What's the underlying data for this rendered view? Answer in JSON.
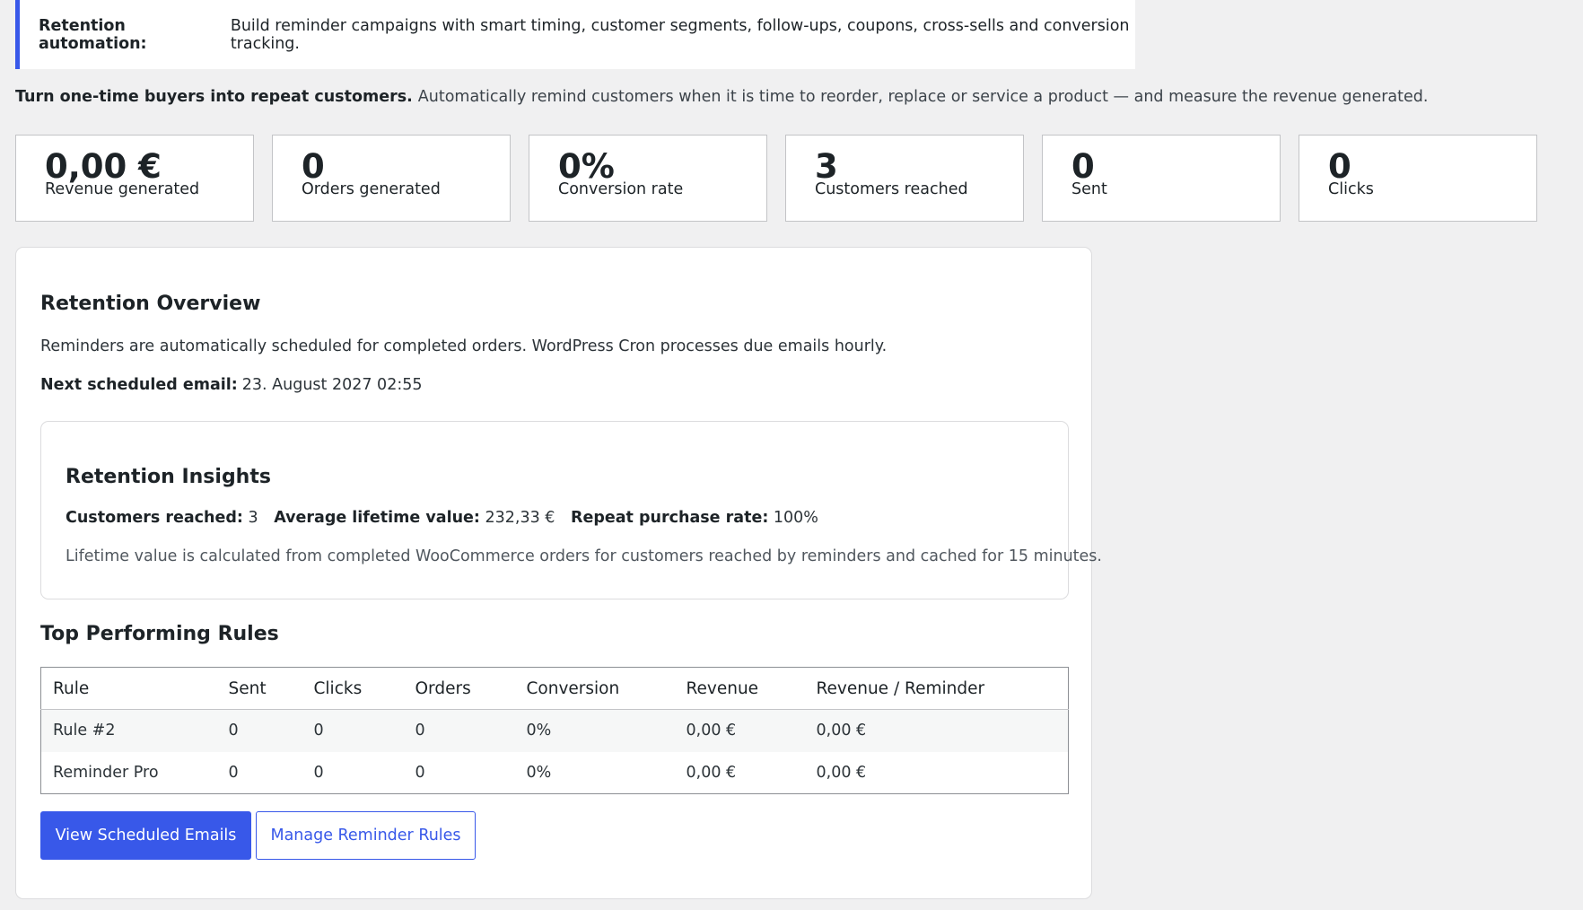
{
  "notice": {
    "title": "Retention automation:",
    "text": "Build reminder campaigns with smart timing, customer segments, follow-ups, coupons, cross-sells and conversion tracking."
  },
  "intro": {
    "bold": "Turn one-time buyers into repeat customers.",
    "text": "Automatically remind customers when it is time to reorder, replace or service a product — and measure the revenue generated."
  },
  "kpis": [
    {
      "value": "0,00 €",
      "label": "Revenue generated"
    },
    {
      "value": "0",
      "label": "Orders generated"
    },
    {
      "value": "0%",
      "label": "Conversion rate"
    },
    {
      "value": "3",
      "label": "Customers reached"
    },
    {
      "value": "0",
      "label": "Sent"
    },
    {
      "value": "0",
      "label": "Clicks"
    }
  ],
  "overview": {
    "title": "Retention Overview",
    "description": "Reminders are automatically scheduled for completed orders. WordPress Cron processes due emails hourly.",
    "next_label": "Next scheduled email:",
    "next_value": "23. August 2027 02:55"
  },
  "insights": {
    "title": "Retention Insights",
    "customers_label": "Customers reached:",
    "customers_value": "3",
    "ltv_label": "Average lifetime value:",
    "ltv_value": "232,33 €",
    "repeat_label": "Repeat purchase rate:",
    "repeat_value": "100%",
    "note": "Lifetime value is calculated from completed WooCommerce orders for customers reached by reminders and cached for 15 minutes."
  },
  "rules": {
    "title": "Top Performing Rules",
    "columns": [
      "Rule",
      "Sent",
      "Clicks",
      "Orders",
      "Conversion",
      "Revenue",
      "Revenue / Reminder"
    ],
    "rows": [
      [
        "Rule #2",
        "0",
        "0",
        "0",
        "0%",
        "0,00 €",
        "0,00 €"
      ],
      [
        "Reminder Pro",
        "0",
        "0",
        "0",
        "0%",
        "0,00 €",
        "0,00 €"
      ]
    ]
  },
  "buttons": {
    "view_scheduled": "View Scheduled Emails",
    "manage_rules": "Manage Reminder Rules"
  },
  "colors": {
    "accent": "#3858e9",
    "background": "#f0f0f1"
  }
}
